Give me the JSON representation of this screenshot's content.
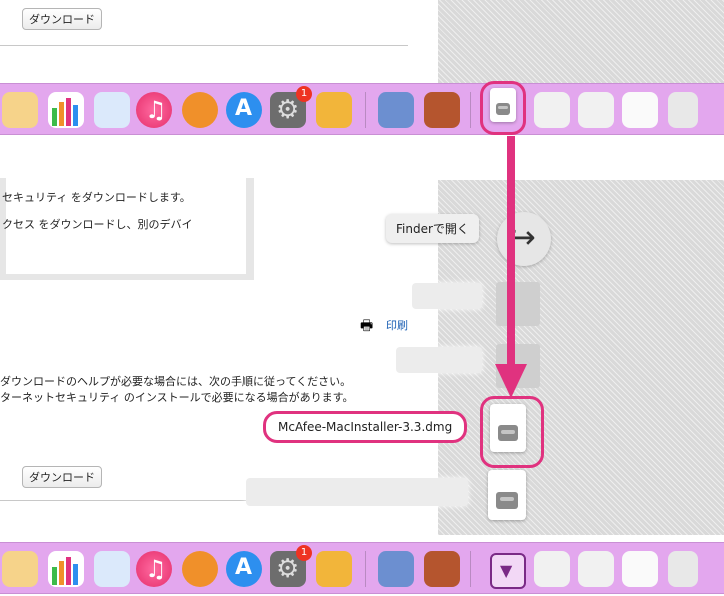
{
  "top_section": {
    "download_button_label": "ダウンロード"
  },
  "dock": {
    "apps": [
      {
        "name": "pages-app-icon",
        "color": "#f4a73a"
      },
      {
        "name": "numbers-app-icon",
        "color": "#3cbb4a"
      },
      {
        "name": "keynote-app-icon",
        "color": "#3a8fe0"
      },
      {
        "name": "itunes-app-icon",
        "color": "#f04a7a"
      },
      {
        "name": "books-app-icon",
        "color": "#f0902a"
      },
      {
        "name": "app-store-icon",
        "color": "#2d8fef"
      },
      {
        "name": "system-preferences-icon",
        "color": "#8a8a8a"
      },
      {
        "name": "folder-app-icon",
        "color": "#f2b53a"
      },
      {
        "name": "preview-app-icon",
        "color": "#5a7ec8"
      },
      {
        "name": "installer-app-icon",
        "color": "#b5552e"
      }
    ],
    "sysprefs_badge": "1"
  },
  "middle_section": {
    "text1": "セキュリティ をダウンロードします。",
    "text2": "クセス をダウンロードし、別のデバイ",
    "finder_menu_label": "Finderで開く",
    "print_link": "印刷",
    "text3": "ダウンロードのヘルプが必要な場合には、次の手順に従ってください。",
    "text4": "ターネットセキュリティ のインストールで必要になる場合があります。",
    "download_filename": "McAfee-MacInstaller-3.3.dmg",
    "download_button_label": "ダウンロード"
  },
  "colors": {
    "accent": "#e0327f",
    "dock_bg": "#e3a7ee"
  }
}
